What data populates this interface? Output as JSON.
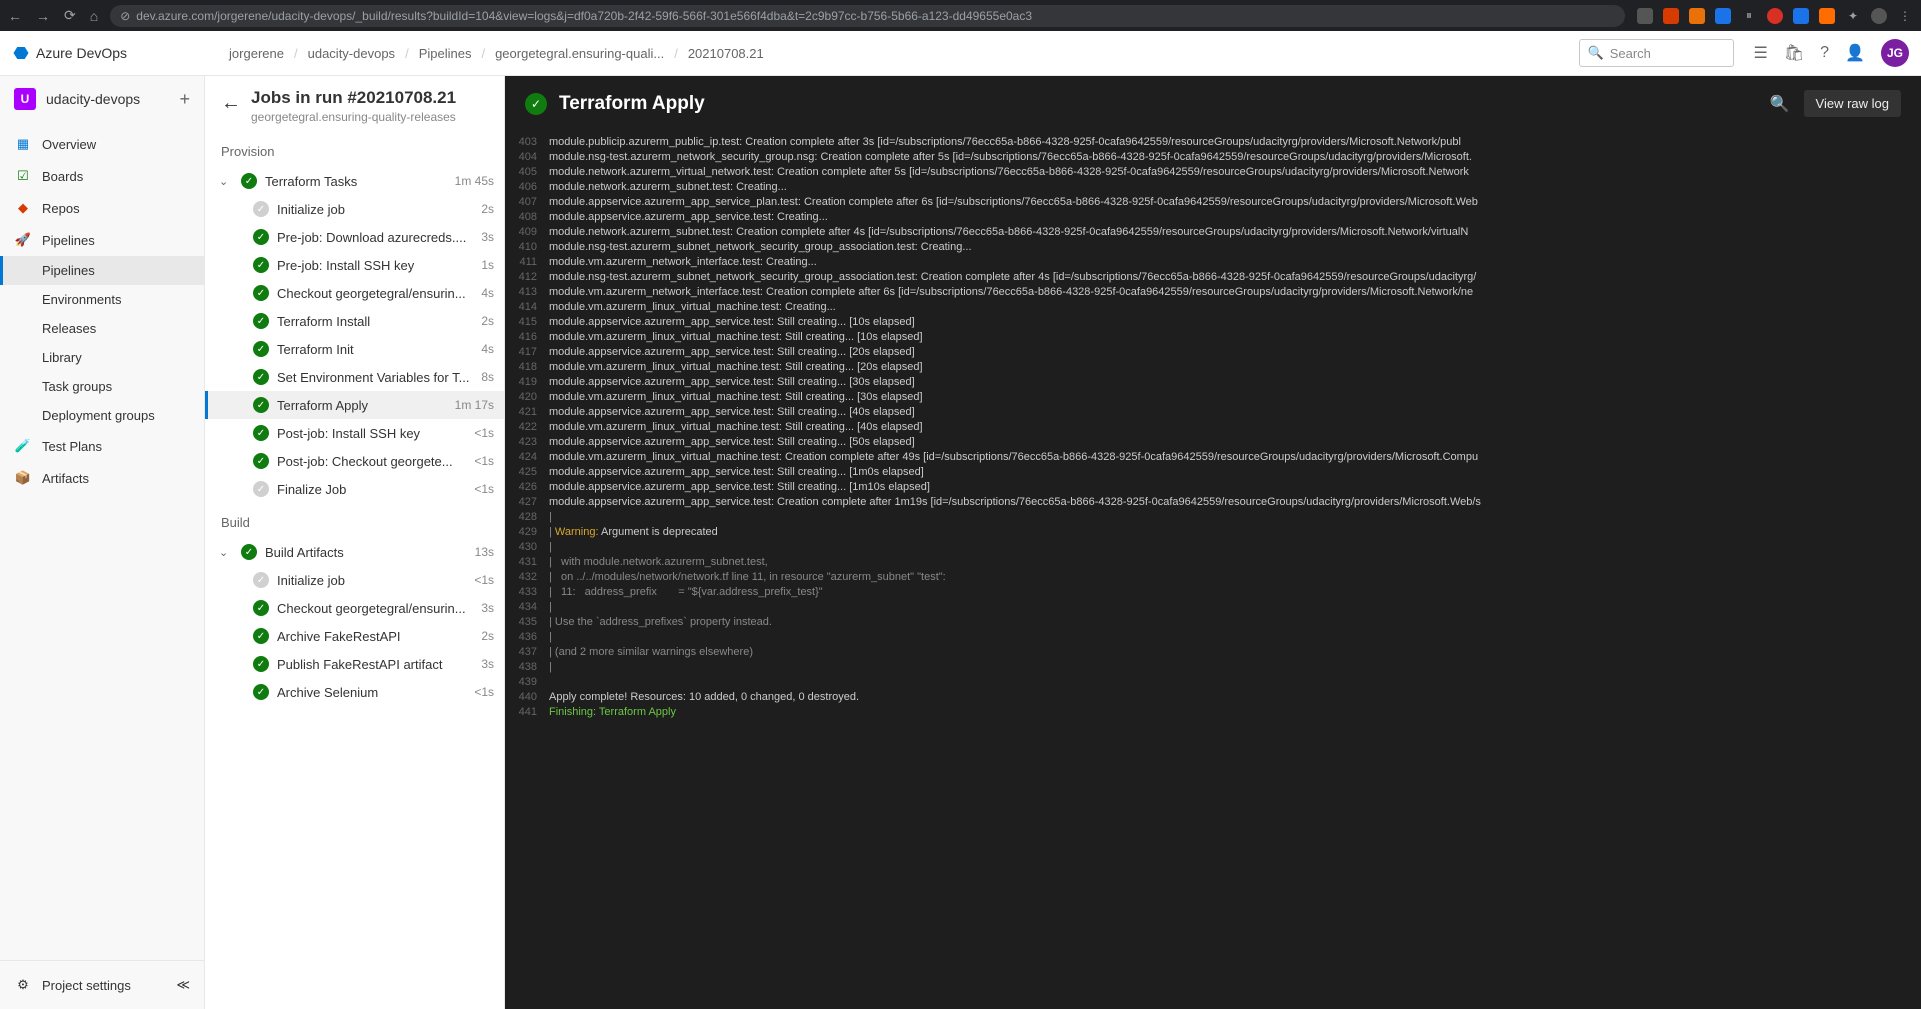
{
  "browser": {
    "url": "dev.azure.com/jorgerene/udacity-devops/_build/results?buildId=104&view=logs&j=df0a720b-2f42-59f6-566f-301e566f4dba&t=2c9b97cc-b756-5b66-a123-dd49655e0ac3"
  },
  "header": {
    "product": "Azure DevOps",
    "breadcrumbs": [
      "jorgerene",
      "udacity-devops",
      "Pipelines",
      "georgetegral.ensuring-quali...",
      "20210708.21"
    ],
    "search_placeholder": "Search",
    "avatar": "JG"
  },
  "left_nav": {
    "project": "udacity-devops",
    "items": [
      {
        "label": "Overview",
        "icon": "overview"
      },
      {
        "label": "Boards",
        "icon": "boards"
      },
      {
        "label": "Repos",
        "icon": "repos"
      },
      {
        "label": "Pipelines",
        "icon": "pipelines",
        "expanded": true,
        "children": [
          {
            "label": "Pipelines",
            "selected": true
          },
          {
            "label": "Environments"
          },
          {
            "label": "Releases"
          },
          {
            "label": "Library"
          },
          {
            "label": "Task groups"
          },
          {
            "label": "Deployment groups"
          }
        ]
      },
      {
        "label": "Test Plans",
        "icon": "testplans"
      },
      {
        "label": "Artifacts",
        "icon": "artifacts"
      }
    ],
    "settings": "Project settings"
  },
  "run_panel": {
    "title": "Jobs in run #20210708.21",
    "subtitle": "georgetegral.ensuring-quality-releases",
    "stages": [
      {
        "name": "Provision",
        "jobs": [
          {
            "label": "Terraform Tasks",
            "status": "success",
            "time": "1m 45s",
            "steps": [
              {
                "label": "Initialize job",
                "status": "neutral",
                "time": "2s"
              },
              {
                "label": "Pre-job: Download azurecreds....",
                "status": "success",
                "time": "3s"
              },
              {
                "label": "Pre-job: Install SSH key",
                "status": "success",
                "time": "1s"
              },
              {
                "label": "Checkout georgetegral/ensurin...",
                "status": "success",
                "time": "4s"
              },
              {
                "label": "Terraform Install",
                "status": "success",
                "time": "2s"
              },
              {
                "label": "Terraform Init",
                "status": "success",
                "time": "4s"
              },
              {
                "label": "Set Environment Variables for T...",
                "status": "success",
                "time": "8s"
              },
              {
                "label": "Terraform Apply",
                "status": "success",
                "time": "1m 17s",
                "selected": true
              },
              {
                "label": "Post-job: Install SSH key",
                "status": "success",
                "time": "<1s"
              },
              {
                "label": "Post-job: Checkout georgete...",
                "status": "success",
                "time": "<1s"
              },
              {
                "label": "Finalize Job",
                "status": "neutral",
                "time": "<1s"
              }
            ]
          }
        ]
      },
      {
        "name": "Build",
        "jobs": [
          {
            "label": "Build Artifacts",
            "status": "success",
            "time": "13s",
            "steps": [
              {
                "label": "Initialize job",
                "status": "neutral",
                "time": "<1s"
              },
              {
                "label": "Checkout georgetegral/ensurin...",
                "status": "success",
                "time": "3s"
              },
              {
                "label": "Archive FakeRestAPI",
                "status": "success",
                "time": "2s"
              },
              {
                "label": "Publish FakeRestAPI artifact",
                "status": "success",
                "time": "3s"
              },
              {
                "label": "Archive Selenium",
                "status": "success",
                "time": "<1s"
              }
            ]
          }
        ]
      }
    ]
  },
  "log": {
    "title": "Terraform Apply",
    "view_raw": "View raw log",
    "lines": [
      {
        "n": 403,
        "t": "module.publicip.azurerm_public_ip.test: Creation complete after 3s [id=/subscriptions/76ecc65a-b866-4328-925f-0cafa9642559/resourceGroups/udacityrg/providers/Microsoft.Network/publ"
      },
      {
        "n": 404,
        "t": "module.nsg-test.azurerm_network_security_group.nsg: Creation complete after 5s [id=/subscriptions/76ecc65a-b866-4328-925f-0cafa9642559/resourceGroups/udacityrg/providers/Microsoft."
      },
      {
        "n": 405,
        "t": "module.network.azurerm_virtual_network.test: Creation complete after 5s [id=/subscriptions/76ecc65a-b866-4328-925f-0cafa9642559/resourceGroups/udacityrg/providers/Microsoft.Network"
      },
      {
        "n": 406,
        "t": "module.network.azurerm_subnet.test: Creating..."
      },
      {
        "n": 407,
        "t": "module.appservice.azurerm_app_service_plan.test: Creation complete after 6s [id=/subscriptions/76ecc65a-b866-4328-925f-0cafa9642559/resourceGroups/udacityrg/providers/Microsoft.Web"
      },
      {
        "n": 408,
        "t": "module.appservice.azurerm_app_service.test: Creating..."
      },
      {
        "n": 409,
        "t": "module.network.azurerm_subnet.test: Creation complete after 4s [id=/subscriptions/76ecc65a-b866-4328-925f-0cafa9642559/resourceGroups/udacityrg/providers/Microsoft.Network/virtualN"
      },
      {
        "n": 410,
        "t": "module.nsg-test.azurerm_subnet_network_security_group_association.test: Creating..."
      },
      {
        "n": 411,
        "t": "module.vm.azurerm_network_interface.test: Creating..."
      },
      {
        "n": 412,
        "t": "module.nsg-test.azurerm_subnet_network_security_group_association.test: Creation complete after 4s [id=/subscriptions/76ecc65a-b866-4328-925f-0cafa9642559/resourceGroups/udacityrg/"
      },
      {
        "n": 413,
        "t": "module.vm.azurerm_network_interface.test: Creation complete after 6s [id=/subscriptions/76ecc65a-b866-4328-925f-0cafa9642559/resourceGroups/udacityrg/providers/Microsoft.Network/ne"
      },
      {
        "n": 414,
        "t": "module.vm.azurerm_linux_virtual_machine.test: Creating..."
      },
      {
        "n": 415,
        "t": "module.appservice.azurerm_app_service.test: Still creating... [10s elapsed]"
      },
      {
        "n": 416,
        "t": "module.vm.azurerm_linux_virtual_machine.test: Still creating... [10s elapsed]"
      },
      {
        "n": 417,
        "t": "module.appservice.azurerm_app_service.test: Still creating... [20s elapsed]"
      },
      {
        "n": 418,
        "t": "module.vm.azurerm_linux_virtual_machine.test: Still creating... [20s elapsed]"
      },
      {
        "n": 419,
        "t": "module.appservice.azurerm_app_service.test: Still creating... [30s elapsed]"
      },
      {
        "n": 420,
        "t": "module.vm.azurerm_linux_virtual_machine.test: Still creating... [30s elapsed]"
      },
      {
        "n": 421,
        "t": "module.appservice.azurerm_app_service.test: Still creating... [40s elapsed]"
      },
      {
        "n": 422,
        "t": "module.vm.azurerm_linux_virtual_machine.test: Still creating... [40s elapsed]"
      },
      {
        "n": 423,
        "t": "module.appservice.azurerm_app_service.test: Still creating... [50s elapsed]"
      },
      {
        "n": 424,
        "t": "module.vm.azurerm_linux_virtual_machine.test: Creation complete after 49s [id=/subscriptions/76ecc65a-b866-4328-925f-0cafa9642559/resourceGroups/udacityrg/providers/Microsoft.Compu"
      },
      {
        "n": 425,
        "t": "module.appservice.azurerm_app_service.test: Still creating... [1m0s elapsed]"
      },
      {
        "n": 426,
        "t": "module.appservice.azurerm_app_service.test: Still creating... [1m10s elapsed]"
      },
      {
        "n": 427,
        "t": "module.appservice.azurerm_app_service.test: Creation complete after 1m19s [id=/subscriptions/76ecc65a-b866-4328-925f-0cafa9642559/resourceGroups/udacityrg/providers/Microsoft.Web/s"
      },
      {
        "n": 428,
        "t": "|",
        "pipe": true
      },
      {
        "n": 429,
        "t": "| Warning: Argument is deprecated",
        "warn": true
      },
      {
        "n": 430,
        "t": "|",
        "pipe": true
      },
      {
        "n": 431,
        "t": "|   with module.network.azurerm_subnet.test,",
        "pipe": true
      },
      {
        "n": 432,
        "t": "|   on ../../modules/network/network.tf line 11, in resource \"azurerm_subnet\" \"test\":",
        "pipe": true
      },
      {
        "n": 433,
        "t": "|   11:   address_prefix       = \"${var.address_prefix_test}\"",
        "pipe": true
      },
      {
        "n": 434,
        "t": "|",
        "pipe": true
      },
      {
        "n": 435,
        "t": "| Use the `address_prefixes` property instead.",
        "pipe": true
      },
      {
        "n": 436,
        "t": "|",
        "pipe": true
      },
      {
        "n": 437,
        "t": "| (and 2 more similar warnings elsewhere)",
        "pipe": true
      },
      {
        "n": 438,
        "t": "|",
        "pipe": true
      },
      {
        "n": 439,
        "t": ""
      },
      {
        "n": 440,
        "t": "Apply complete! Resources: 10 added, 0 changed, 0 destroyed."
      },
      {
        "n": 441,
        "t": "Finishing: Terraform Apply",
        "green": true
      }
    ]
  }
}
